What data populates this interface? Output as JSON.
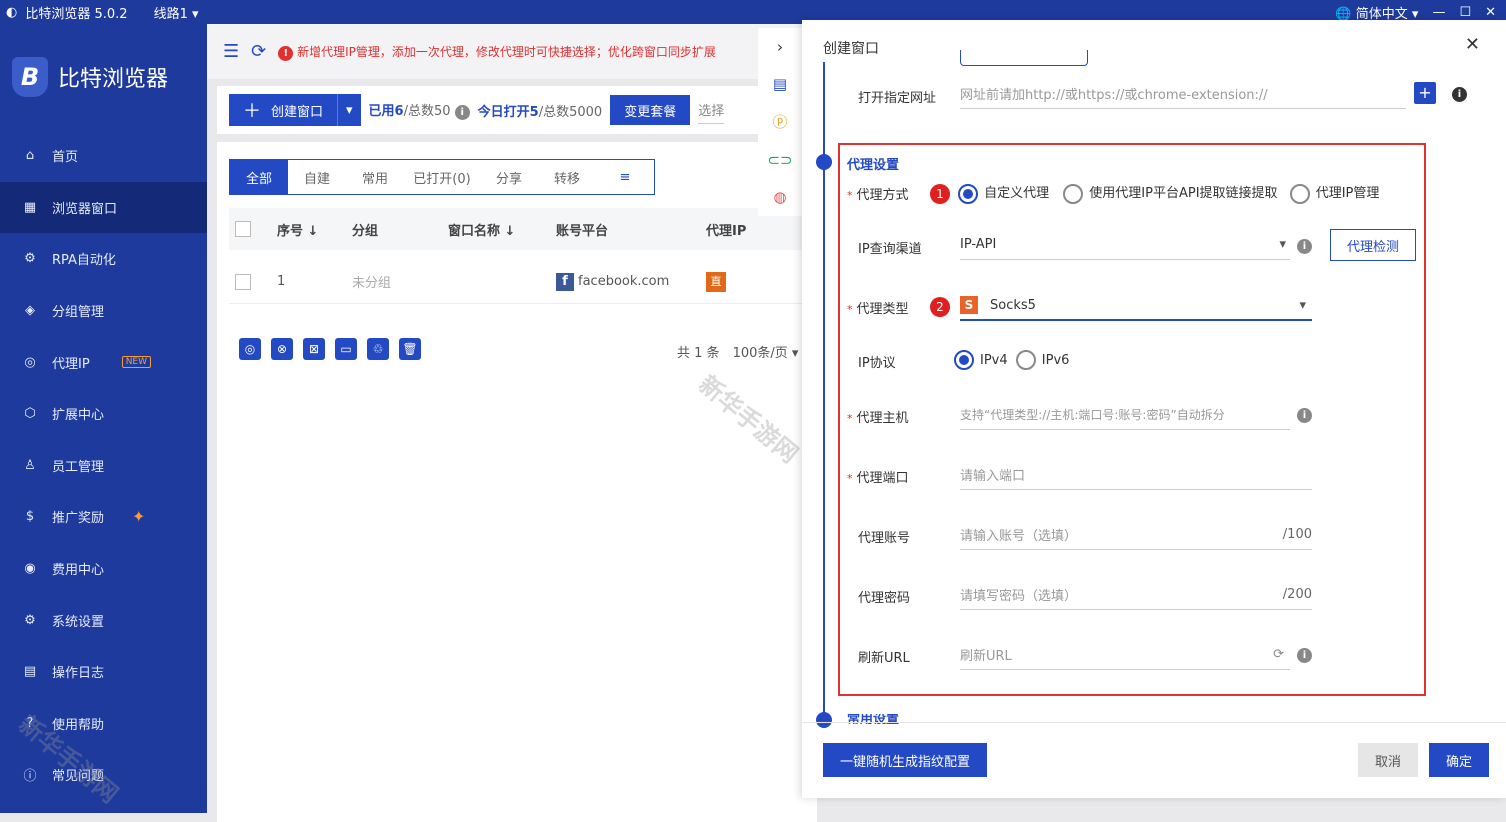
{
  "titlebar": {
    "app": "比特浏览器 5.0.2",
    "line": "线路1",
    "lang": "简体中文",
    "min": "—",
    "max": "☐",
    "close": "✕"
  },
  "logo": {
    "text": "比特浏览器",
    "mark": "B"
  },
  "sidebar": {
    "items": [
      {
        "label": "首页",
        "icon": "⌂"
      },
      {
        "label": "浏览器窗口",
        "icon": "▦"
      },
      {
        "label": "RPA自动化",
        "icon": "⚙"
      },
      {
        "label": "分组管理",
        "icon": "◈"
      },
      {
        "label": "代理IP",
        "icon": "◎",
        "badge": "NEW"
      },
      {
        "label": "扩展中心",
        "icon": "⬡"
      },
      {
        "label": "员工管理",
        "icon": "♙"
      },
      {
        "label": "推广奖励",
        "icon": "$",
        "spark": "✦"
      },
      {
        "label": "费用中心",
        "icon": "◉"
      },
      {
        "label": "系统设置",
        "icon": "⚙"
      },
      {
        "label": "操作日志",
        "icon": "▤"
      },
      {
        "label": "使用帮助",
        "icon": "?"
      },
      {
        "label": "常见问题",
        "icon": "ⓘ"
      }
    ]
  },
  "topbar": {
    "notice": "新增代理IP管理，添加一次代理，修改代理时可快捷选择；优化跨窗口同步扩展"
  },
  "toolbar": {
    "create": "创建窗口",
    "used": "已用6",
    "total": "/总数50",
    "today": "今日打开5",
    "today_total": "/总数5000",
    "change": "变更套餐",
    "select": "选择"
  },
  "tabs": [
    "全部",
    "自建",
    "常用",
    "已打开(0)",
    "分享",
    "转移"
  ],
  "table": {
    "headers": [
      "序号 ↓",
      "分组",
      "窗口名称 ↓",
      "账号平台",
      "代理IP"
    ],
    "row": {
      "index": "1",
      "group": "未分组",
      "platform": "facebook.com",
      "proxy": "直"
    }
  },
  "pager": {
    "total": "共 1 条",
    "size": "100条/页"
  },
  "modal": {
    "title": "创建窗口",
    "open_url_label": "打开指定网址",
    "open_url_placeholder": "网址前请加http://或https://或chrome-extension://",
    "section": "代理设置",
    "proxy_mode_label": "代理方式",
    "modes": [
      "自定义代理",
      "使用代理IP平台API提取链接提取",
      "代理IP管理"
    ],
    "ip_channel_label": "IP查询渠道",
    "ip_channel_value": "IP-API",
    "check_btn": "代理检测",
    "proxy_type_label": "代理类型",
    "proxy_type_value": "Socks5",
    "ip_protocol_label": "IP协议",
    "protocols": [
      "IPv4",
      "IPv6"
    ],
    "host_label": "代理主机",
    "host_placeholder": "支持“代理类型://主机:端口号:账号:密码”自动拆分",
    "port_label": "代理端口",
    "port_placeholder": "请输入端口",
    "account_label": "代理账号",
    "account_placeholder": "请输入账号（选填）",
    "account_max": "/100",
    "password_label": "代理密码",
    "password_placeholder": "请填写密码（选填）",
    "password_max": "/200",
    "refresh_label": "刷新URL",
    "refresh_placeholder": "刷新URL",
    "next_section": "常用设置",
    "random_btn": "一键随机生成指纹配置",
    "cancel": "取消",
    "ok": "确定",
    "step1": "1",
    "step2": "2"
  },
  "watermark": "新华手游网",
  "colors": {
    "primary": "#2449c4",
    "sidebar": "#1e3a9c",
    "danger": "#e02020"
  }
}
